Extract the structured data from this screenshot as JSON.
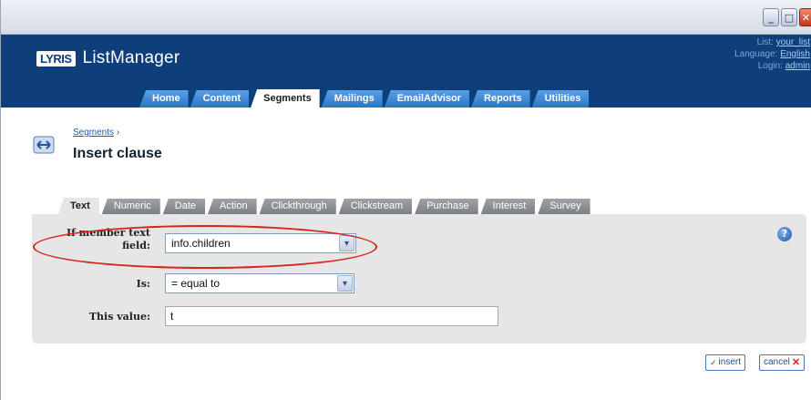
{
  "header": {
    "logo_badge": "LYRIS",
    "app_name": "ListManager",
    "list_label": "List:",
    "list_value": "your_list",
    "language_label": "Language:",
    "language_value": "English",
    "login_label": "Login:",
    "login_value": "admin"
  },
  "nav": {
    "tabs": [
      {
        "label": "Home"
      },
      {
        "label": "Content"
      },
      {
        "label": "Segments"
      },
      {
        "label": "Mailings"
      },
      {
        "label": "EmailAdvisor"
      },
      {
        "label": "Reports"
      },
      {
        "label": "Utilities"
      }
    ],
    "active": "Segments"
  },
  "breadcrumb": {
    "link": "Segments",
    "separator": "›"
  },
  "page_title": "Insert clause",
  "subtabs": {
    "tabs": [
      {
        "label": "Text"
      },
      {
        "label": "Numeric"
      },
      {
        "label": "Date"
      },
      {
        "label": "Action"
      },
      {
        "label": "Clickthrough"
      },
      {
        "label": "Clickstream"
      },
      {
        "label": "Purchase"
      },
      {
        "label": "Interest"
      },
      {
        "label": "Survey"
      }
    ],
    "active": "Text"
  },
  "form": {
    "field_label_line1": "If member text",
    "field_label_line2": "field:",
    "field_value": "info.children",
    "is_label": "Is:",
    "is_value": "= equal to",
    "value_label": "This value:",
    "value_value": "t"
  },
  "buttons": {
    "insert": "insert",
    "cancel": "cancel"
  },
  "icons": {
    "help": "?",
    "dropdown": "▾",
    "minimize": "_",
    "maximize": "□",
    "close": "✕"
  },
  "colors": {
    "header_bg": "#0f3f7a",
    "nav_tab": "#3a86d6",
    "subtab": "#8c8f93",
    "panel": "#e6e6e6",
    "highlight": "#d8231a"
  }
}
